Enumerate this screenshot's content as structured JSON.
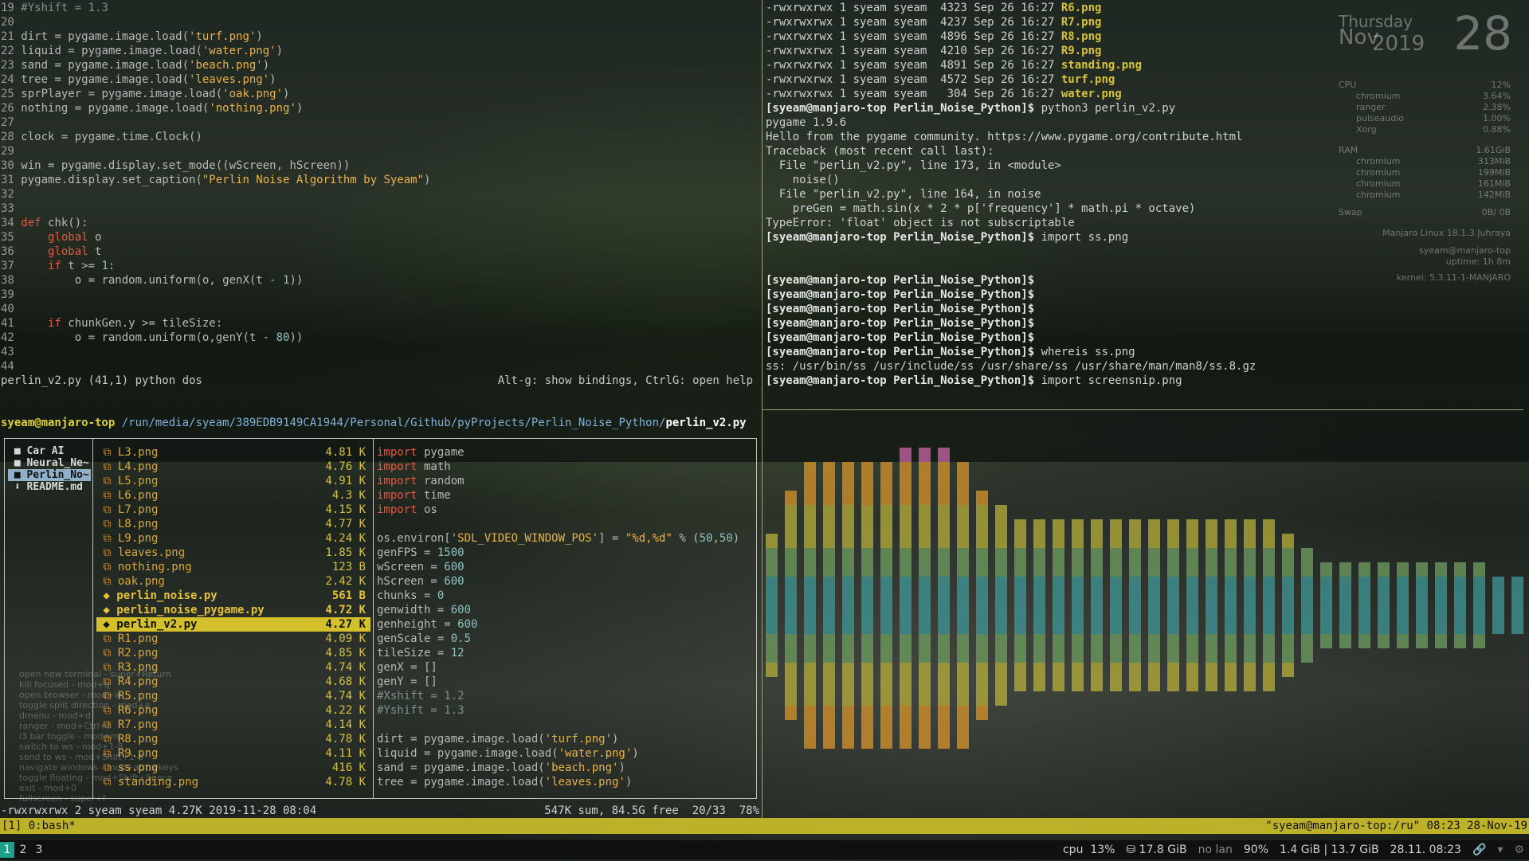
{
  "editor": {
    "lines": [
      [
        [
          "ln",
          "19 "
        ],
        [
          "cm",
          "#Yshift = 1.3"
        ]
      ],
      [
        [
          "ln",
          "20"
        ]
      ],
      [
        [
          "ln",
          "21 "
        ],
        [
          "t",
          "dirt = pygame.image.load("
        ],
        [
          "str",
          "'turf.png'"
        ],
        [
          "t",
          ")"
        ]
      ],
      [
        [
          "ln",
          "22 "
        ],
        [
          "t",
          "liquid = pygame.image.load("
        ],
        [
          "str",
          "'water.png'"
        ],
        [
          "t",
          ")"
        ]
      ],
      [
        [
          "ln",
          "23 "
        ],
        [
          "t",
          "sand = pygame.image.load("
        ],
        [
          "str",
          "'beach.png'"
        ],
        [
          "t",
          ")"
        ]
      ],
      [
        [
          "ln",
          "24 "
        ],
        [
          "t",
          "tree = pygame.image.load("
        ],
        [
          "str",
          "'leaves.png'"
        ],
        [
          "t",
          ")"
        ]
      ],
      [
        [
          "ln",
          "25 "
        ],
        [
          "t",
          "sprPlayer = pygame.image.load("
        ],
        [
          "str",
          "'oak.png'"
        ],
        [
          "t",
          ")"
        ]
      ],
      [
        [
          "ln",
          "26 "
        ],
        [
          "t",
          "nothing = pygame.image.load("
        ],
        [
          "str",
          "'nothing.png'"
        ],
        [
          "t",
          ")"
        ]
      ],
      [
        [
          "ln",
          "27"
        ]
      ],
      [
        [
          "ln",
          "28 "
        ],
        [
          "t",
          "clock = pygame.time.Clock()"
        ]
      ],
      [
        [
          "ln",
          "29"
        ]
      ],
      [
        [
          "ln",
          "30 "
        ],
        [
          "t",
          "win = pygame.display.set_mode((wScreen, hScreen))"
        ]
      ],
      [
        [
          "ln",
          "31 "
        ],
        [
          "t",
          "pygame.display.set_caption("
        ],
        [
          "str",
          "\"Perlin Noise Algorithm by Syeam\""
        ],
        [
          "t",
          ")"
        ]
      ],
      [
        [
          "ln",
          "32"
        ]
      ],
      [
        [
          "ln",
          "33"
        ]
      ],
      [
        [
          "ln",
          "34 "
        ],
        [
          "kw",
          "def"
        ],
        [
          "t",
          " chk():"
        ]
      ],
      [
        [
          "ln",
          "35 "
        ],
        [
          "t",
          "    "
        ],
        [
          "kw",
          "global"
        ],
        [
          "t",
          " o"
        ]
      ],
      [
        [
          "ln",
          "36 "
        ],
        [
          "t",
          "    "
        ],
        [
          "kw",
          "global"
        ],
        [
          "t",
          " t"
        ]
      ],
      [
        [
          "ln",
          "37 "
        ],
        [
          "t",
          "    "
        ],
        [
          "kw",
          "if"
        ],
        [
          "t",
          " t >= "
        ],
        [
          "num",
          "1"
        ],
        [
          "t",
          ":"
        ]
      ],
      [
        [
          "ln",
          "38 "
        ],
        [
          "t",
          "        o = random.uniform(o, genX(t - "
        ],
        [
          "num",
          "1"
        ],
        [
          "t",
          "))"
        ]
      ],
      [
        [
          "ln",
          "39"
        ]
      ],
      [
        [
          "ln",
          "40"
        ]
      ],
      [
        [
          "ln",
          "41 "
        ],
        [
          "t",
          "    "
        ],
        [
          "kw",
          "if"
        ],
        [
          "t",
          " chunkGen.y >= tileSize:"
        ]
      ],
      [
        [
          "ln",
          "42 "
        ],
        [
          "t",
          "        o = random.uniform(o,genY(t - "
        ],
        [
          "num",
          "80"
        ],
        [
          "t",
          "))"
        ]
      ],
      [
        [
          "ln",
          "43"
        ]
      ],
      [
        [
          "ln",
          "44"
        ]
      ]
    ],
    "status_left": "perlin_v2.py (41,1) python dos",
    "status_right": "Alt-g: show bindings, CtrlG: open help"
  },
  "terminal": {
    "ls_rows": [
      {
        "perm": "-rwxrwxrwx 1 syeam syeam  4323 Sep 26 16:27 ",
        "name": "R6.png"
      },
      {
        "perm": "-rwxrwxrwx 1 syeam syeam  4237 Sep 26 16:27 ",
        "name": "R7.png"
      },
      {
        "perm": "-rwxrwxrwx 1 syeam syeam  4896 Sep 26 16:27 ",
        "name": "R8.png"
      },
      {
        "perm": "-rwxrwxrwx 1 syeam syeam  4210 Sep 26 16:27 ",
        "name": "R9.png"
      },
      {
        "perm": "-rwxrwxrwx 1 syeam syeam  4891 Sep 26 16:27 ",
        "name": "standing.png"
      },
      {
        "perm": "-rwxrwxrwx 1 syeam syeam  4572 Sep 26 16:27 ",
        "name": "turf.png"
      },
      {
        "perm": "-rwxrwxrwx 1 syeam syeam   304 Sep 26 16:27 ",
        "name": "water.png"
      }
    ],
    "lines": [
      {
        "prompt": "[syeam@manjaro-top Perlin_Noise_Python]$",
        "text": " python3 perlin_v2.py"
      },
      {
        "prompt": "",
        "text": "pygame 1.9.6"
      },
      {
        "prompt": "",
        "text": "Hello from the pygame community. https://www.pygame.org/contribute.html"
      },
      {
        "prompt": "",
        "text": "Traceback (most recent call last):"
      },
      {
        "prompt": "",
        "text": "  File \"perlin_v2.py\", line 173, in <module>"
      },
      {
        "prompt": "",
        "text": "    noise()"
      },
      {
        "prompt": "",
        "text": "  File \"perlin_v2.py\", line 164, in noise"
      },
      {
        "prompt": "",
        "text": "    preGen = math.sin(x * 2 * p['frequency'] * math.pi * octave)"
      },
      {
        "prompt": "",
        "text": "TypeError: 'float' object is not subscriptable"
      },
      {
        "prompt": "[syeam@manjaro-top Perlin_Noise_Python]$",
        "text": " import ss.png"
      },
      {
        "prompt": "",
        "text": ""
      },
      {
        "prompt": "",
        "text": ""
      },
      {
        "prompt": "[syeam@manjaro-top Perlin_Noise_Python]$",
        "text": ""
      },
      {
        "prompt": "[syeam@manjaro-top Perlin_Noise_Python]$",
        "text": ""
      },
      {
        "prompt": "[syeam@manjaro-top Perlin_Noise_Python]$",
        "text": ""
      },
      {
        "prompt": "[syeam@manjaro-top Perlin_Noise_Python]$",
        "text": ""
      },
      {
        "prompt": "[syeam@manjaro-top Perlin_Noise_Python]$",
        "text": ""
      },
      {
        "prompt": "[syeam@manjaro-top Perlin_Noise_Python]$",
        "text": " whereis ss.png"
      },
      {
        "prompt": "",
        "text": "ss: /usr/bin/ss /usr/include/ss /usr/share/ss /usr/share/man/man8/ss.8.gz"
      },
      {
        "prompt": "[syeam@manjaro-top Perlin_Noise_Python]$",
        "text": " import screensnip.png"
      }
    ]
  },
  "ranger": {
    "host": "syeam@manjaro-top",
    "path": " /run/media/syeam/389EDB9149CA1944/Personal/Github/pyProjects/Perlin_Noise_Python/",
    "file": "perlin_v2.py",
    "parent": [
      {
        "icon": "■",
        "name": "Car AI",
        "sel": false
      },
      {
        "icon": "■",
        "name": "Neural_Ne~",
        "sel": false
      },
      {
        "icon": "■",
        "name": "Perlin_No~",
        "sel": true
      },
      {
        "icon": "⬇",
        "name": "README.md",
        "sel": false
      }
    ],
    "files": [
      {
        "icon": "⧉",
        "name": "L3.png",
        "size": "4.81 K",
        "type": "png"
      },
      {
        "icon": "⧉",
        "name": "L4.png",
        "size": "4.76 K",
        "type": "png"
      },
      {
        "icon": "⧉",
        "name": "L5.png",
        "size": "4.91 K",
        "type": "png"
      },
      {
        "icon": "⧉",
        "name": "L6.png",
        "size": "4.3 K",
        "type": "png"
      },
      {
        "icon": "⧉",
        "name": "L7.png",
        "size": "4.15 K",
        "type": "png"
      },
      {
        "icon": "⧉",
        "name": "L8.png",
        "size": "4.77 K",
        "type": "png"
      },
      {
        "icon": "⧉",
        "name": "L9.png",
        "size": "4.24 K",
        "type": "png"
      },
      {
        "icon": "⧉",
        "name": "leaves.png",
        "size": "1.85 K",
        "type": "png"
      },
      {
        "icon": "⧉",
        "name": "nothing.png",
        "size": "123 B",
        "type": "png"
      },
      {
        "icon": "⧉",
        "name": "oak.png",
        "size": "2.42 K",
        "type": "png"
      },
      {
        "icon": "◆",
        "name": "perlin_noise.py",
        "size": "561 B",
        "type": "py"
      },
      {
        "icon": "◆",
        "name": "perlin_noise_pygame.py",
        "size": "4.72 K",
        "type": "py"
      },
      {
        "icon": "◆",
        "name": "perlin_v2.py",
        "size": "4.27 K",
        "type": "sel"
      },
      {
        "icon": "⧉",
        "name": "R1.png",
        "size": "4.09 K",
        "type": "png"
      },
      {
        "icon": "⧉",
        "name": "R2.png",
        "size": "4.85 K",
        "type": "png"
      },
      {
        "icon": "⧉",
        "name": "R3.png",
        "size": "4.74 K",
        "type": "png"
      },
      {
        "icon": "⧉",
        "name": "R4.png",
        "size": "4.68 K",
        "type": "png"
      },
      {
        "icon": "⧉",
        "name": "R5.png",
        "size": "4.74 K",
        "type": "png"
      },
      {
        "icon": "⧉",
        "name": "R6.png",
        "size": "4.22 K",
        "type": "png"
      },
      {
        "icon": "⧉",
        "name": "R7.png",
        "size": "4.14 K",
        "type": "png"
      },
      {
        "icon": "⧉",
        "name": "R8.png",
        "size": "4.78 K",
        "type": "png"
      },
      {
        "icon": "⧉",
        "name": "R9.png",
        "size": "4.11 K",
        "type": "png"
      },
      {
        "icon": "⧉",
        "name": "ss.png",
        "size": "416 K",
        "type": "png"
      },
      {
        "icon": "⧉",
        "name": "standing.png",
        "size": "4.78 K",
        "type": "png"
      }
    ],
    "preview": [
      [
        [
          "kw",
          "import"
        ],
        [
          "t",
          " pygame"
        ]
      ],
      [
        [
          "kw",
          "import"
        ],
        [
          "t",
          " math"
        ]
      ],
      [
        [
          "kw",
          "import"
        ],
        [
          "t",
          " random"
        ]
      ],
      [
        [
          "kw",
          "import"
        ],
        [
          "t",
          " time"
        ]
      ],
      [
        [
          "kw",
          "import"
        ],
        [
          "t",
          " os"
        ]
      ],
      [
        [
          "t",
          ""
        ]
      ],
      [
        [
          "t",
          "os.environ["
        ],
        [
          "str",
          "'SDL_VIDEO_WINDOW_POS'"
        ],
        [
          "t",
          "] = "
        ],
        [
          "str",
          "\"%d,%d\""
        ],
        [
          "t",
          " % ("
        ],
        [
          "num",
          "50"
        ],
        [
          "t",
          ","
        ],
        [
          "num",
          "50"
        ],
        [
          "t",
          ")"
        ]
      ],
      [
        [
          "t",
          "genFPS = "
        ],
        [
          "num",
          "1500"
        ]
      ],
      [
        [
          "t",
          "wScreen = "
        ],
        [
          "num",
          "600"
        ]
      ],
      [
        [
          "t",
          "hScreen = "
        ],
        [
          "num",
          "600"
        ]
      ],
      [
        [
          "t",
          "chunks = "
        ],
        [
          "num",
          "0"
        ]
      ],
      [
        [
          "t",
          "genwidth = "
        ],
        [
          "num",
          "600"
        ]
      ],
      [
        [
          "t",
          "genheight = "
        ],
        [
          "num",
          "600"
        ]
      ],
      [
        [
          "t",
          "genScale = "
        ],
        [
          "num",
          "0.5"
        ]
      ],
      [
        [
          "t",
          "tileSize = "
        ],
        [
          "num",
          "12"
        ]
      ],
      [
        [
          "t",
          "genX = []"
        ]
      ],
      [
        [
          "t",
          "genY = []"
        ]
      ],
      [
        [
          "cm",
          "#Xshift = 1.2"
        ]
      ],
      [
        [
          "cm",
          "#Yshift = 1.3"
        ]
      ],
      [
        [
          "t",
          ""
        ]
      ],
      [
        [
          "t",
          "dirt = pygame.image.load("
        ],
        [
          "str",
          "'turf.png'"
        ],
        [
          "t",
          ")"
        ]
      ],
      [
        [
          "t",
          "liquid = pygame.image.load("
        ],
        [
          "str",
          "'water.png'"
        ],
        [
          "t",
          ")"
        ]
      ],
      [
        [
          "t",
          "sand = pygame.image.load("
        ],
        [
          "str",
          "'beach.png'"
        ],
        [
          "t",
          ")"
        ]
      ],
      [
        [
          "t",
          "tree = pygame.image.load("
        ],
        [
          "str",
          "'leaves.png'"
        ],
        [
          "t",
          ")"
        ]
      ]
    ],
    "status_left": "-rwxrwxrwx 2 syeam syeam 4.27K 2019-11-28 08:04",
    "status_right": "547K sum, 84.5G free  20/33  78%"
  },
  "tmux": {
    "left": "[1] 0:bash*",
    "right": "\"syeam@manjaro-top:/ru\" 08:23 28-Nov-19"
  },
  "bar": {
    "workspaces": [
      "1",
      "2",
      "3"
    ],
    "cpu_label": "cpu",
    "cpu_value": "13%",
    "disk": "17.8 GiB",
    "net": "no lan",
    "battery": "90%",
    "mem": "1.4 GiB | 13.7 GiB",
    "datetime": "28.11. 08:23"
  },
  "conky": {
    "day": "Thursday",
    "month": "Nov",
    "year": "2019",
    "date": "28",
    "cpu_label": "CPU",
    "cpu_value": "12%",
    "procs": [
      [
        "chromium",
        "3.64%"
      ],
      [
        "ranger",
        "2.38%"
      ],
      [
        "pulseaudio",
        "1.00%"
      ],
      [
        "Xorg",
        "0.88%"
      ]
    ],
    "ram_label": "RAM",
    "ram_value": "1.61GiB",
    "mems": [
      [
        "chromium",
        "313MiB"
      ],
      [
        "chromium",
        "199MiB"
      ],
      [
        "chromium",
        "161MiB"
      ],
      [
        "chromium",
        "142MiB"
      ]
    ],
    "swap_label": "Swap",
    "swap_value": "0B/ 0B",
    "os": "Manjaro Linux 18.1.3 Juhraya",
    "host": "syeam@manjaro-top",
    "uptime": "uptime: 1h 8m",
    "kernel": "kernel: 5.3.11-1-MANJARO"
  },
  "hints": [
    "open new terminal - super+Return",
    "kill focused - mod+q",
    "open browser - mod+w",
    "toggle split direction - mod+e",
    "dmenu - mod+d",
    "ranger - mod+Ctrl+f",
    "i3 bar toggle - mod+m",
    "switch to ws - mod+1-8",
    "send to ws - mod+Shift+1-8",
    "navigate windows - mod+arrowkeys",
    "toggle floating - mod+Shift+Space",
    "exit - mod+0",
    "fullscreen - super+f"
  ],
  "visualizer": {
    "levels": [
      5,
      8,
      10,
      10,
      10,
      10,
      10,
      11,
      11,
      11,
      10,
      8,
      7,
      6,
      6,
      6,
      6,
      6,
      6,
      6,
      6,
      6,
      6,
      6,
      6,
      6,
      6,
      5,
      4,
      3,
      3,
      3,
      3,
      3,
      3,
      3,
      3,
      3,
      2,
      2,
      2
    ],
    "colors": {
      "top": "#cc66aa",
      "orange": "#d9962a",
      "yellow": "#b8b03a",
      "green": "#6fa060",
      "teal": "#3f9a9a"
    }
  }
}
